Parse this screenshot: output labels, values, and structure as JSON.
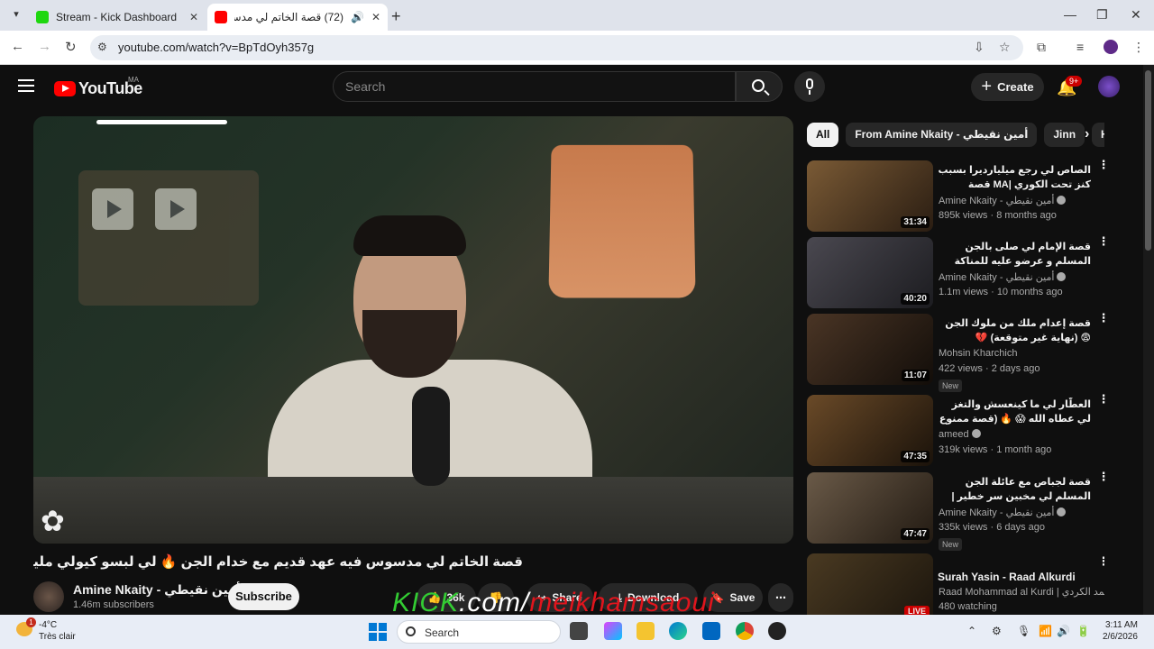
{
  "browser": {
    "tabs": [
      {
        "title": "Stream - Kick Dashboard"
      },
      {
        "title": "(72) قصة الخاتم لي مدسوس"
      }
    ],
    "url": "youtube.com/watch?v=BpTdOyh357g"
  },
  "youtube": {
    "logo_text": "YouTube",
    "country": "MA",
    "search_placeholder": "Search",
    "create_label": "Create",
    "notif_badge": "9+"
  },
  "video": {
    "title": "قصة الخاتم لي مدسوس فيه عهد قديم مع خدام الجن 🔥 لي لبسو كيولي مليونير 😱 | قصة الذهبيي",
    "channel": "Amine Nkaity - أمين نقيطي",
    "subscribers": "1.46m subscribers",
    "subscribe_label": "Subscribe",
    "likes": "36k",
    "share_label": "Share",
    "download_label": "Download",
    "save_label": "Save"
  },
  "stream_overlay": {
    "part1": "KICK",
    "part2": ".com/",
    "part3": "meikhamsaoui"
  },
  "chips": [
    "All",
    "From Amine Nkaity - أمين نقيطي",
    "Jinn",
    "Hi"
  ],
  "recommendations": [
    {
      "title": "الصاص لي رجع ميليارديرا بسبب كنز تحت الكوري |MA قصة مغربية مشوقة",
      "channel": "Amine Nkaity - أمين نقيطي",
      "views": "895k views",
      "age": "8 months ago",
      "duration": "31:34",
      "badge": "",
      "thumb": "#6a4a2b"
    },
    {
      "title": "قصة الإمام لي صلى بالجن المسلم و عرضو عليه للمناكة",
      "channel": "Amine Nkaity - أمين نقيطي",
      "views": "1.1m views",
      "age": "10 months ago",
      "duration": "40:20",
      "badge": "",
      "thumb": "#3b3a3d"
    },
    {
      "title": "قصة إعدام ملك من ملوك الجن 😨 (نهاية غير متوقعة) 💔",
      "channel": "Mohsin Kharchich",
      "views": "422 views",
      "age": "2 days ago",
      "duration": "11:07",
      "badge": "New",
      "thumb": "#3a2a1f"
    },
    {
      "title": "العطّار لي ما كينعسش والتغز لي عطاه الله 😱 🔥 (قصة ممنوع تعودها)",
      "channel": "ameed",
      "views": "319k views",
      "age": "1 month ago",
      "duration": "47:35",
      "badge": "",
      "thumb": "#4a3420"
    },
    {
      "title": "قصة لجباص مع عائلة الجن المسلم لي مخبين سر خطير | هتشي وقع في فيلا مغربية",
      "channel": "Amine Nkaity - أمين نقيطي",
      "views": "335k views",
      "age": "6 days ago",
      "duration": "47:47",
      "badge": "New",
      "thumb": "#4b3e2e"
    },
    {
      "title": "Surah Yasin - Raad Alkurdi",
      "channel": "Raad Mohammad al Kurdi | رعد محمد الكردي",
      "views": "480 watching",
      "age": "",
      "duration": "LIVE",
      "badge": "",
      "thumb": "#2d2519"
    }
  ],
  "taskbar": {
    "temp": "-4°C",
    "condition": "Très clair",
    "weather_badge": "1",
    "search_label": "Search",
    "time": "3:11 AM",
    "date": "2/6/2026"
  },
  "colors": {
    "accent": "#ff0000",
    "kick_green": "#33cc33",
    "kick_red": "#e0151d"
  }
}
